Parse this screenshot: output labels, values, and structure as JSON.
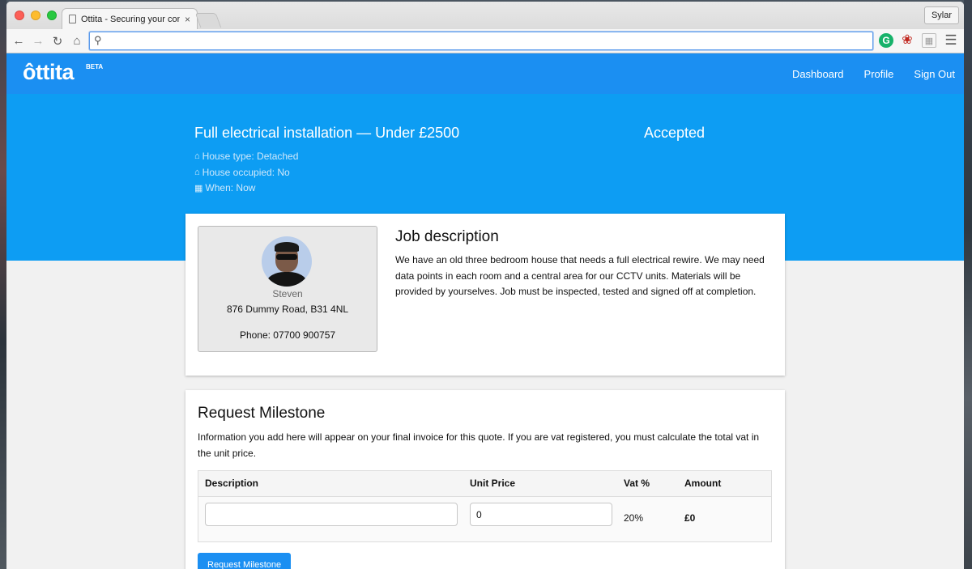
{
  "browser": {
    "tab_title": "Ottita - Securing your cont",
    "tab_close": "×",
    "profile_name": "Sylar",
    "address_value": ""
  },
  "navbar": {
    "logo": "ttita",
    "logo_hat": "ô",
    "beta": "BETA",
    "links": [
      "Dashboard",
      "Profile",
      "Sign Out"
    ]
  },
  "job": {
    "title": "Full electrical installation — Under £2500",
    "status": "Accepted",
    "house_type": "House type: Detached",
    "house_occupied": "House occupied: No",
    "when": "When: Now"
  },
  "customer": {
    "name": "Steven",
    "address": "876 Dummy Road, B31 4NL",
    "phone": "Phone: 07700 900757"
  },
  "description": {
    "heading": "Job description",
    "text": "We have an old three bedroom house that needs a full electrical rewire. We may need data points in each room and a central area for our CCTV units. Materials will be provided by yourselves. Job must be inspected, tested and signed off at completion."
  },
  "milestone": {
    "heading": "Request Milestone",
    "info": "Information you add here will appear on your final invoice for this quote. If you are vat registered, you must calculate the total vat in the unit price.",
    "columns": [
      "Description",
      "Unit Price",
      "Vat %",
      "Amount"
    ],
    "row": {
      "description": "",
      "unit_price": "0",
      "vat": "20%",
      "amount": "£0"
    },
    "button": "Request Milestone"
  }
}
